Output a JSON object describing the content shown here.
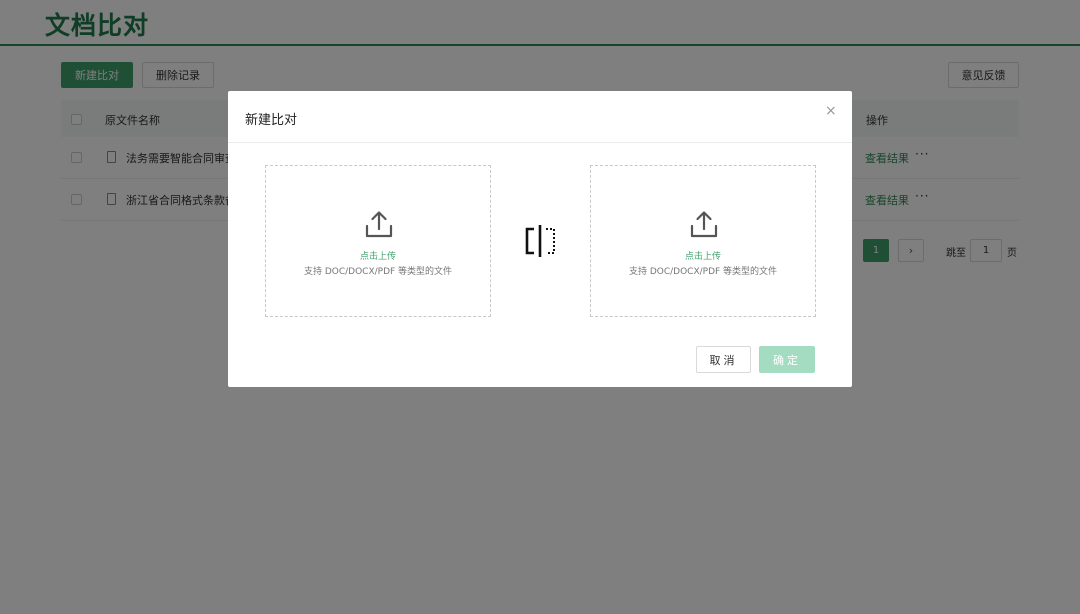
{
  "app": {
    "logo_text": "文档比对"
  },
  "toolbar": {
    "new_compare_label": "新建比对",
    "delete_records_label": "删除记录",
    "feedback_label": "意见反馈"
  },
  "table": {
    "columns": {
      "name": "原文件名称",
      "actions": "操作"
    },
    "rows": [
      {
        "file_name": "法务需要智能合同审查",
        "view_label": "查看结果",
        "more_label": "···"
      },
      {
        "file_name": "浙江省合同格式条款备",
        "view_label": "查看结果",
        "more_label": "···"
      }
    ]
  },
  "pagination": {
    "current_page": "1",
    "next_label": "›",
    "jump_label": "跳至",
    "jump_value": "1",
    "page_suffix": "页"
  },
  "modal": {
    "title": "新建比对",
    "close_label": "×",
    "left_upload": {
      "link_text": "点击上传",
      "hint": "支持 DOC/DOCX/PDF 等类型的文件"
    },
    "right_upload": {
      "link_text": "点击上传",
      "hint": "支持 DOC/DOCX/PDF 等类型的文件"
    },
    "cancel_label": "取消",
    "ok_label": "确定"
  },
  "icons": {
    "upload": "upload-icon",
    "compare": "compare-icon",
    "file": "file-icon",
    "close": "close-icon"
  },
  "colors": {
    "brand": "#3fa06d",
    "link": "#2e8b57",
    "ok_disabled": "#a3dcc0",
    "overlay": "rgba(0,0,0,0.5)"
  }
}
